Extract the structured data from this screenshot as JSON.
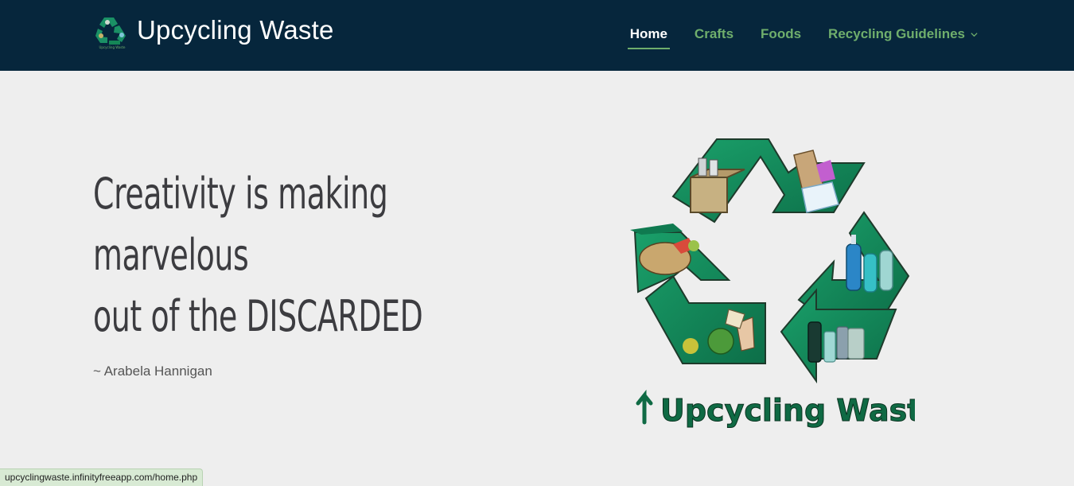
{
  "header": {
    "brand_name": "Upcycling Waste",
    "brand_logo_icon": "recycle-logo-icon"
  },
  "nav": {
    "items": [
      {
        "label": "Home",
        "active": true
      },
      {
        "label": "Crafts",
        "active": false
      },
      {
        "label": "Foods",
        "active": false
      },
      {
        "label": "Recycling Guidelines",
        "active": false,
        "dropdown": true
      }
    ]
  },
  "hero": {
    "quote_lines": [
      "Creativity is making",
      "marvelous",
      "out of the DISCARDED"
    ],
    "author": "~ Arabela Hannigan",
    "logo_caption": "Upcycling Waste"
  },
  "status": {
    "url": "upcyclingwaste.infinityfreeapp.com/home.php"
  },
  "colors": {
    "header_bg": "#06263c",
    "accent": "#6fae6c",
    "page_bg": "#eeeeee",
    "logo_green": "#138a5c"
  }
}
